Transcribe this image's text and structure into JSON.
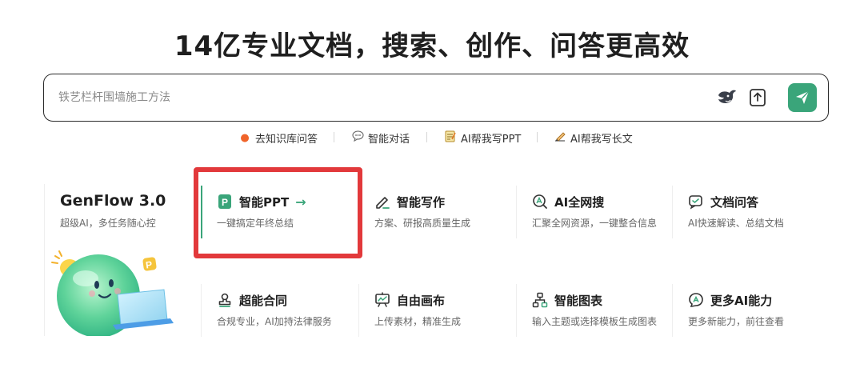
{
  "headline": "14亿专业文档，搜索、创作、问答更高效",
  "search": {
    "placeholder": "铁艺栏杆围墙施工方法",
    "icons": {
      "model": "deepseek-whale-icon",
      "upload": "upload-icon",
      "send": "send-plane-icon"
    },
    "send_color": "#3aa57a"
  },
  "quick_links": [
    {
      "icon": "fire-icon",
      "label": "去知识库问答"
    },
    {
      "icon": "chat-bubble-icon",
      "label": "智能对话"
    },
    {
      "icon": "memo-icon",
      "label": "AI帮我写PPT"
    },
    {
      "icon": "writing-hand-icon",
      "label": "AI帮我写长文"
    }
  ],
  "featured": {
    "title": "GenFlow 3.0",
    "subtitle": "超级AI，多任务随心控",
    "image": "genflow-mascot"
  },
  "cards": [
    {
      "id": "smart-ppt",
      "title": "智能PPT",
      "arrow": "→",
      "subtitle": "一键搞定年终总结",
      "icon": "ppt-icon",
      "highlighted": true
    },
    {
      "id": "smart-writing",
      "title": "智能写作",
      "subtitle": "方案、研报高质量生成",
      "icon": "pen-icon"
    },
    {
      "id": "ai-web-search",
      "title": "AI全网搜",
      "subtitle": "汇聚全网资源，一键整合信息",
      "icon": "ai-search-icon"
    },
    {
      "id": "doc-qa",
      "title": "文档问答",
      "subtitle": "AI快速解读、总结文档",
      "icon": "doc-chat-icon"
    },
    {
      "id": "super-contract",
      "title": "超能合同",
      "subtitle": "合规专业，AI加持法律服务",
      "icon": "stamp-icon"
    },
    {
      "id": "free-canvas",
      "title": "自由画布",
      "subtitle": "上传素材，精准生成",
      "icon": "easel-icon"
    },
    {
      "id": "smart-chart",
      "title": "智能图表",
      "subtitle": "输入主题或选择模板生成图表",
      "icon": "org-chart-icon"
    },
    {
      "id": "more-ai",
      "title": "更多AI能力",
      "subtitle": "更多新能力，前往查看",
      "icon": "ai-bubble-icon"
    }
  ],
  "colors": {
    "accent": "#3aa57a",
    "highlight_box": "#e2393b",
    "text_dark": "#1f1f1f",
    "text_muted": "#666666"
  }
}
